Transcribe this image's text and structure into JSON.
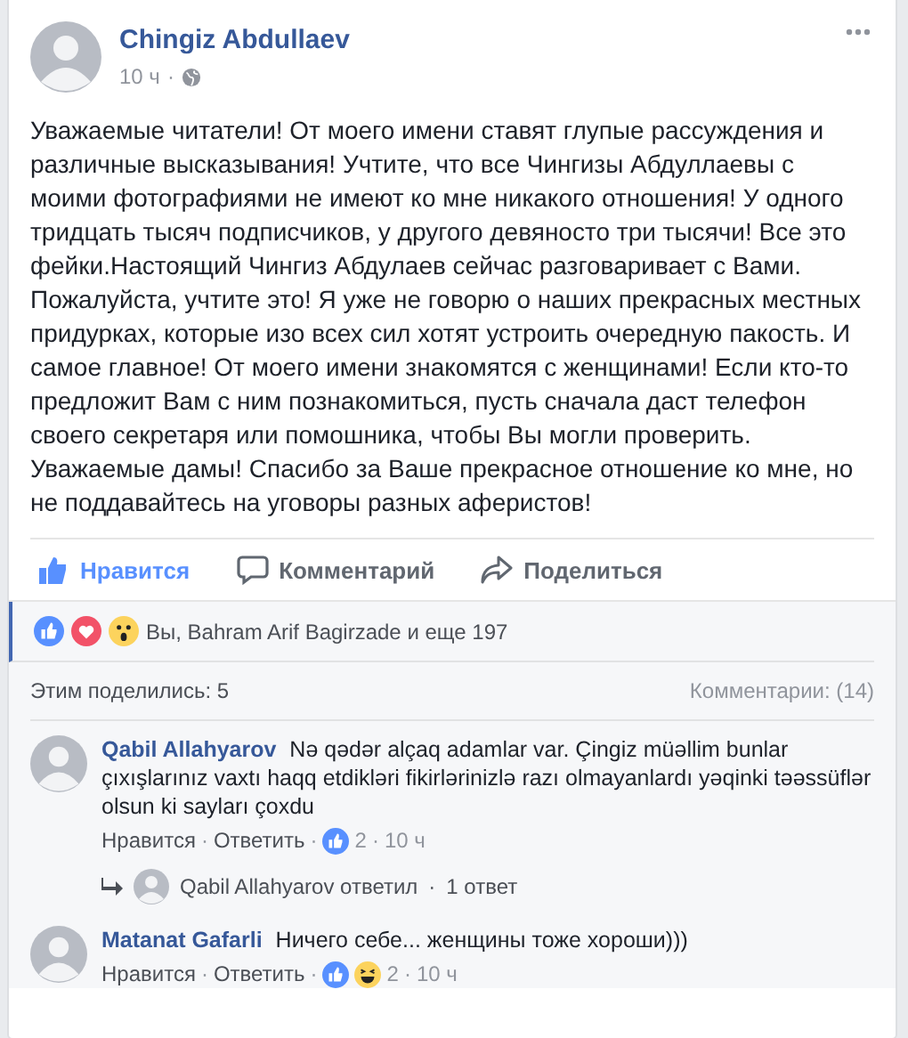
{
  "post": {
    "author": "Chingiz Abdullaev",
    "time": "10 ч",
    "separator": "·",
    "text": "Уважаемые читатели! От моего имени ставят глупые рассуждения и различные высказывания! Учтите, что все Чингизы Абдуллаевы с моими фотографиями не имеют ко мне никакого отношения! У одного тридцать тысяч подписчиков, у другого девяносто три тысячи! Все это фейки.Настоящий Чингиз Абдулаев сейчас разговаривает с Вами. Пожалуйста, учтите это! Я уже не говорю о наших прекрасных местных придурках, которые изо всех сил хотят устроить очередную пакость. И самое главное! От моего имени знакомятся с женщинами! Если кто-то предложит Вам с ним познакомиться, пусть сначала даст телефон своего секретаря или помошника, чтобы Вы могли проверить. Уважаемые дамы! Спасибо за Ваше прекрасное отношение ко мне, но не поддавайтесь на уговоры разных аферистов!"
  },
  "actions": [
    {
      "kind": "like",
      "label": "Нравится",
      "selected": true
    },
    {
      "kind": "comment",
      "label": "Комментарий",
      "selected": false
    },
    {
      "kind": "share",
      "label": "Поделиться",
      "selected": false
    }
  ],
  "reactions": {
    "icons": [
      {
        "kind": "like"
      },
      {
        "kind": "love"
      },
      {
        "kind": "wow"
      }
    ],
    "text": "Вы, Bahram Arif Bagirzade и еще 197"
  },
  "shares": "Этим поделились: 5",
  "comments_count": "Комментарии: (14)",
  "comments": [
    {
      "author": "Qabil Allahyarov",
      "text": "Nə qədər alçaq adamlar var. Çingiz müəllim bunlar çıxışlarınız vaxtı haqq etdikləri fikirlərinizlə razı olmayanlardı yəqinki təəssüflər olsun ki sayları çoxdu",
      "meta": [
        {
          "kind": "like",
          "text": "Нравится"
        },
        {
          "kind": "sep",
          "text": "·"
        },
        {
          "kind": "reply",
          "text": "Ответить"
        },
        {
          "kind": "sep",
          "text": "·"
        },
        {
          "kind": "reactions",
          "icons": [
            {
              "kind": "like"
            }
          ],
          "text": "2"
        },
        {
          "kind": "sep",
          "text": "·"
        },
        {
          "kind": "time",
          "text": "10 ч"
        }
      ],
      "replies_summary": {
        "text": "Qabil Allahyarov ответил",
        "separator": "·",
        "count": "1 ответ"
      }
    },
    {
      "author": "Matanat Gafarli",
      "text": "Ничего себе... женщины тоже хороши)))",
      "meta": [
        {
          "kind": "like",
          "text": "Нравится"
        },
        {
          "kind": "sep",
          "text": "·"
        },
        {
          "kind": "reply",
          "text": "Ответить"
        },
        {
          "kind": "sep",
          "text": "·"
        },
        {
          "kind": "reactions",
          "icons": [
            {
              "kind": "like"
            },
            {
              "kind": "haha"
            }
          ],
          "text": "2"
        },
        {
          "kind": "sep",
          "text": "·"
        },
        {
          "kind": "time",
          "text": "10 ч"
        }
      ]
    }
  ]
}
